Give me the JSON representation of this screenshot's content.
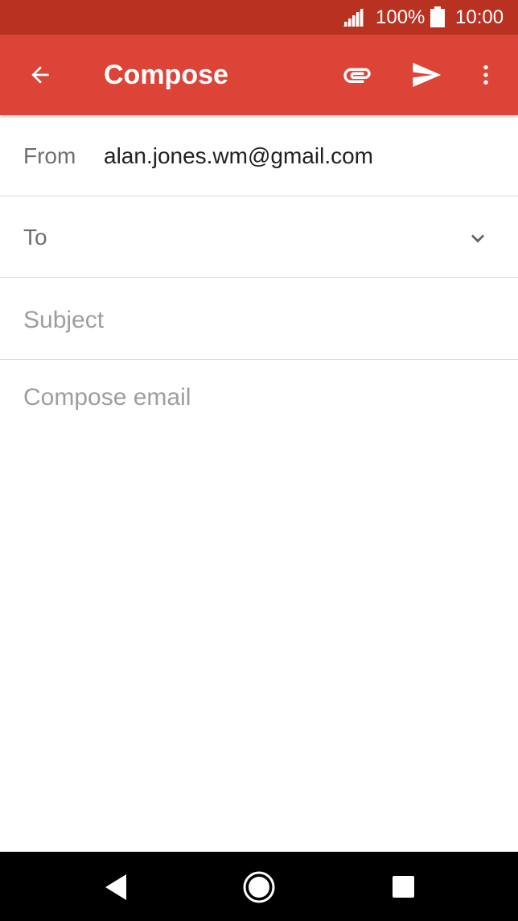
{
  "status_bar": {
    "battery_percent": "100%",
    "time": "10:00",
    "icons": [
      "signal-icon",
      "battery-icon"
    ]
  },
  "app_bar": {
    "title": "Compose",
    "icons": [
      "back-arrow-icon",
      "attachment-icon",
      "send-icon",
      "more-vert-icon"
    ]
  },
  "form": {
    "from_label": "From",
    "from_value": "alan.jones.wm@gmail.com",
    "to_label": "To",
    "subject_placeholder": "Subject",
    "body_placeholder": "Compose email"
  },
  "nav": {
    "icons": [
      "nav-back-icon",
      "nav-home-icon",
      "nav-recents-icon"
    ]
  },
  "colors": {
    "status_bar": "#b93221",
    "app_bar": "#db4437",
    "nav_bar": "#000000"
  }
}
